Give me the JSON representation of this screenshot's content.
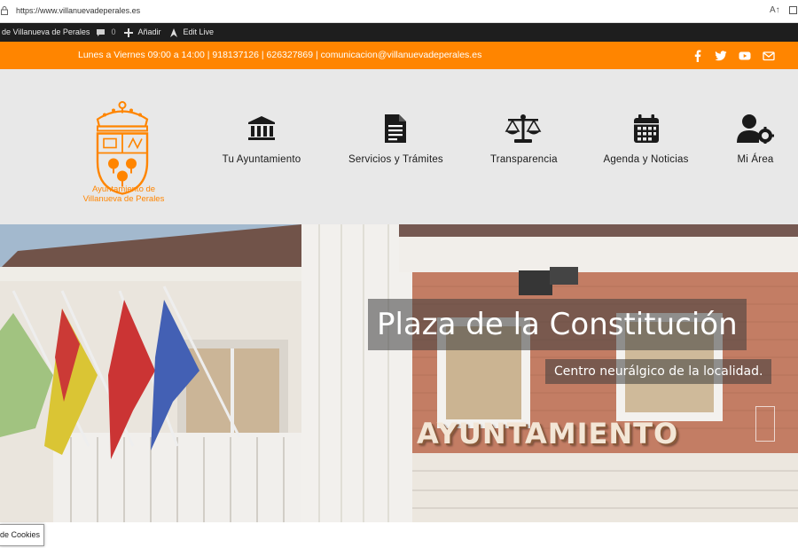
{
  "browser": {
    "url": "https://www.villanuevadeperales.es",
    "read_aloud": "A↑"
  },
  "admin_bar": {
    "site_name": "de Villanueva de Perales",
    "comments_count": "0",
    "add_new": "Añadir",
    "edit_live": "Edit Live"
  },
  "top_bar": {
    "contact": "Lunes a Viernes 09:00 a 14:00 | 918137126 | 626327869 | comunicacion@villanuevadeperales.es",
    "social": [
      "facebook-icon",
      "twitter-icon",
      "youtube-icon",
      "email-icon"
    ],
    "accent": "#ff8500"
  },
  "header": {
    "logo_line1": "Ayuntamiento de",
    "logo_line2": "Villanueva de Perales",
    "nav": [
      {
        "label": "Tu Ayuntamiento",
        "icon": "town-hall-icon"
      },
      {
        "label": "Servicios y Trámites",
        "icon": "document-icon"
      },
      {
        "label": "Transparencia",
        "icon": "scales-icon"
      },
      {
        "label": "Agenda y Noticias",
        "icon": "calendar-icon"
      },
      {
        "label": "Mi Área",
        "icon": "user-settings-icon"
      }
    ]
  },
  "hero": {
    "title": "Plaza de la Constitución",
    "subtitle": "Centro neurálgico de la localidad.",
    "sign": "AYUNTAMIENTO"
  },
  "cookies": {
    "label": "de Cookies"
  }
}
